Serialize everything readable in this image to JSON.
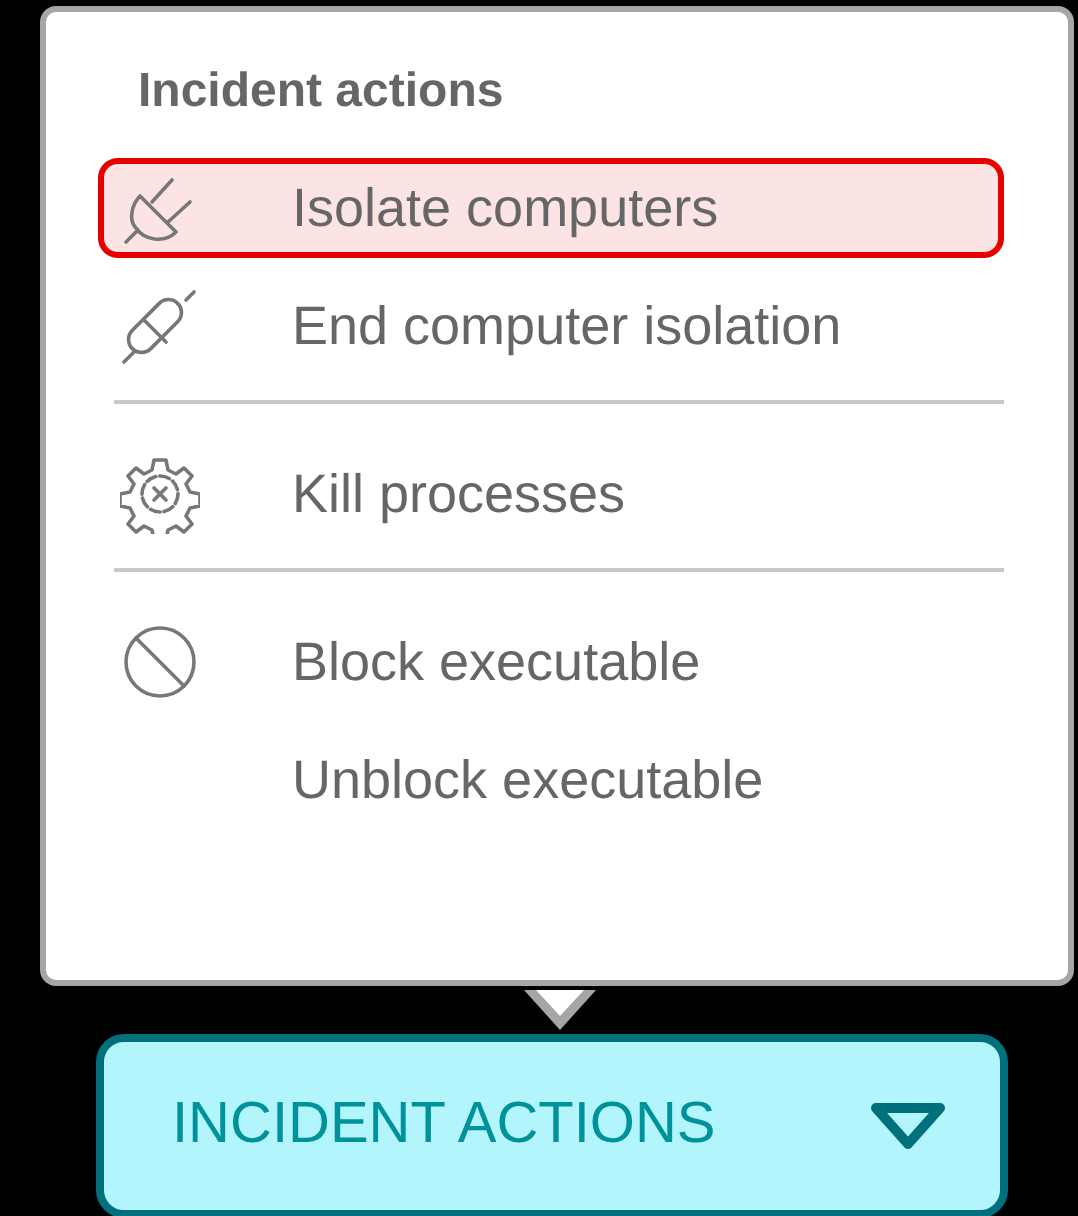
{
  "menu": {
    "title": "Incident actions",
    "sections": [
      {
        "items": [
          {
            "label": "Isolate computers",
            "kind": "plug",
            "selected": true
          },
          {
            "label": "End computer isolation",
            "kind": "unplug",
            "selected": false
          }
        ]
      },
      {
        "items": [
          {
            "label": "Kill processes",
            "kind": "gear",
            "selected": false
          }
        ]
      },
      {
        "items": [
          {
            "label": "Block executable",
            "kind": "block",
            "selected": false
          },
          {
            "label": "Unblock executable",
            "kind": "plain",
            "selected": false
          }
        ]
      }
    ]
  },
  "button": {
    "label": "INCIDENT ACTIONS",
    "expanded": true
  }
}
